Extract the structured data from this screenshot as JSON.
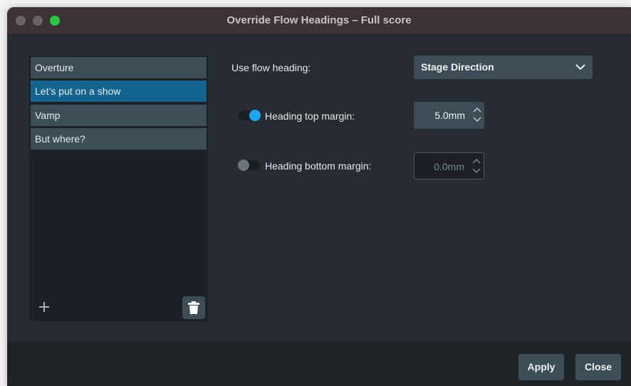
{
  "window": {
    "title": "Override Flow Headings – Full score"
  },
  "flows": {
    "items": [
      {
        "label": "Overture",
        "selected": false
      },
      {
        "label": "Let’s put on a show",
        "selected": true
      },
      {
        "label": "Vamp",
        "selected": false
      },
      {
        "label": "But where?",
        "selected": false
      }
    ],
    "add_icon": "plus-icon",
    "delete_icon": "trash-icon"
  },
  "settings": {
    "use_flow_heading_label": "Use flow heading:",
    "flow_heading_value": "Stage Direction",
    "top_margin": {
      "label": "Heading top margin:",
      "enabled": true,
      "value": "5.0mm"
    },
    "bottom_margin": {
      "label": "Heading bottom margin:",
      "enabled": false,
      "value": "0.0mm"
    }
  },
  "footer": {
    "apply_label": "Apply",
    "close_label": "Close"
  },
  "colors": {
    "accent": "#13658f",
    "toggle_on": "#1aa6f2",
    "maximize": "#2ac840"
  }
}
